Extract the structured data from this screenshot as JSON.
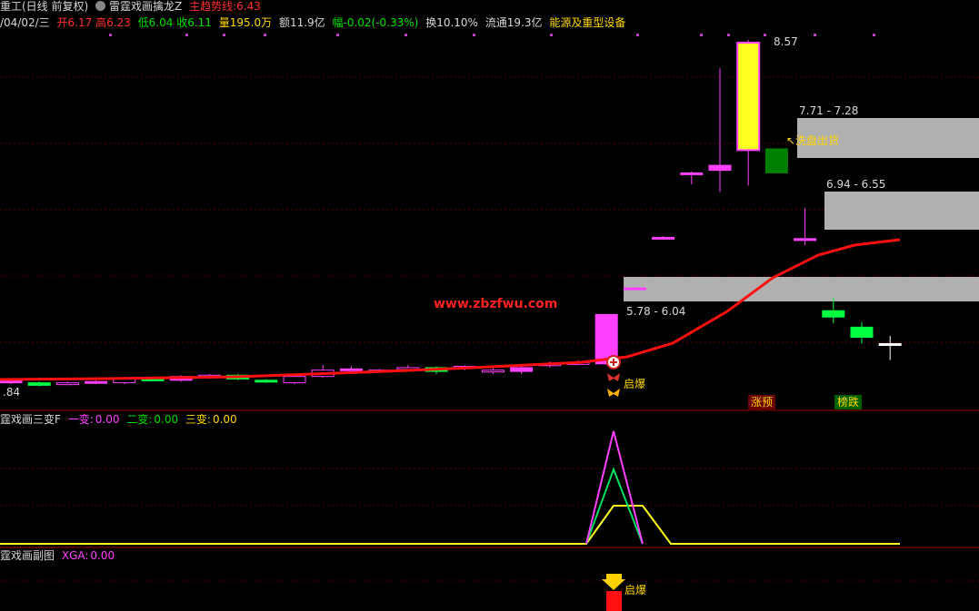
{
  "header": {
    "stock_name": "重工(日线 前复权)",
    "indicator_name": "雷霆戏画擒龙Z",
    "trend_label": "主趋势线:",
    "trend_value": "6.43",
    "date": "/04/02/三",
    "open_label": "开",
    "open": "6.17",
    "high_label": "高",
    "high": "6.23",
    "low_label": "低",
    "low": "6.04",
    "close_label": "收",
    "close": "6.11",
    "volume": "量195.0万",
    "amount": "额11.9亿",
    "change": "幅-0.02(-0.33%)",
    "turnover": "换10.10%",
    "float": "流通19.3亿",
    "sector": "能源及重型设备"
  },
  "panel2": {
    "title": "霆戏画三变F",
    "v1_label": "一变:",
    "v1": "0.00",
    "v2_label": "二变:",
    "v2": "0.00",
    "v3_label": "三变:",
    "v3": "0.00"
  },
  "panel3": {
    "title": "霆戏画副图",
    "xga_label": "XGA:",
    "xga": "0.00",
    "signal": "启爆"
  },
  "annotations": {
    "watermark": "www.zbzfwu.com",
    "high_label": "8.57",
    "low_axis": ".84",
    "zone1": "7.71 - 7.28",
    "zone2": "6.94 - 6.55",
    "zone3": "5.78 - 6.04",
    "washout": "↖洗盘出货",
    "burst": "启爆",
    "tag_up": "涨预",
    "tag_drop": "榜跌"
  },
  "colors": {
    "up": "#ff40ff",
    "down": "#00ff40",
    "ma": "#ff1010",
    "zone": "#b0b0b0",
    "big_up": "#ffff20",
    "big_down": "#008000"
  },
  "chart_data": {
    "type": "candlestick",
    "price_range": [
      5.8,
      8.6
    ],
    "candles": [
      {
        "o": 5.86,
        "c": 5.88,
        "h": 5.89,
        "l": 5.85
      },
      {
        "o": 5.86,
        "c": 5.84,
        "h": 5.87,
        "l": 5.83
      },
      {
        "o": 5.85,
        "c": 5.86,
        "h": 5.87,
        "l": 5.84
      },
      {
        "o": 5.86,
        "c": 5.87,
        "h": 5.88,
        "l": 5.85
      },
      {
        "o": 5.86,
        "c": 5.89,
        "h": 5.9,
        "l": 5.85
      },
      {
        "o": 5.89,
        "c": 5.88,
        "h": 5.9,
        "l": 5.87
      },
      {
        "o": 5.88,
        "c": 5.91,
        "h": 5.92,
        "l": 5.87
      },
      {
        "o": 5.9,
        "c": 5.92,
        "h": 5.93,
        "l": 5.89
      },
      {
        "o": 5.92,
        "c": 5.89,
        "h": 5.93,
        "l": 5.88
      },
      {
        "o": 5.88,
        "c": 5.87,
        "h": 5.89,
        "l": 5.86
      },
      {
        "o": 5.86,
        "c": 5.91,
        "h": 5.92,
        "l": 5.85
      },
      {
        "o": 5.91,
        "c": 5.96,
        "h": 6.0,
        "l": 5.9
      },
      {
        "o": 5.96,
        "c": 5.97,
        "h": 5.99,
        "l": 5.93
      },
      {
        "o": 5.96,
        "c": 5.96,
        "h": 5.97,
        "l": 5.94
      },
      {
        "o": 5.97,
        "c": 5.98,
        "h": 6.0,
        "l": 5.96
      },
      {
        "o": 5.98,
        "c": 5.95,
        "h": 5.99,
        "l": 5.93
      },
      {
        "o": 5.98,
        "c": 5.99,
        "h": 6.0,
        "l": 5.96
      },
      {
        "o": 5.95,
        "c": 5.96,
        "h": 5.98,
        "l": 5.93
      },
      {
        "o": 5.95,
        "c": 5.98,
        "h": 6.0,
        "l": 5.93
      },
      {
        "o": 6.0,
        "c": 6.01,
        "h": 6.03,
        "l": 5.98
      },
      {
        "o": 6.01,
        "c": 6.02,
        "h": 6.04,
        "l": 6.0
      },
      {
        "o": 6.01,
        "c": 6.4,
        "h": 6.4,
        "l": 6.0
      },
      {
        "o": 6.61,
        "c": 6.61,
        "h": 6.62,
        "l": 6.6
      },
      {
        "o": 7.01,
        "c": 7.01,
        "h": 7.02,
        "l": 7.0
      },
      {
        "o": 7.51,
        "c": 7.52,
        "h": 7.53,
        "l": 7.43
      },
      {
        "o": 7.54,
        "c": 7.58,
        "h": 8.35,
        "l": 7.37
      },
      {
        "o": 7.7,
        "c": 8.55,
        "h": 8.57,
        "l": 7.42
      },
      {
        "o": 7.71,
        "c": 7.52,
        "h": 7.71,
        "l": 7.52
      },
      {
        "o": 7.0,
        "c": 7.0,
        "h": 7.24,
        "l": 6.95
      },
      {
        "o": 6.43,
        "c": 6.38,
        "h": 6.53,
        "l": 6.33
      },
      {
        "o": 6.3,
        "c": 6.22,
        "h": 6.34,
        "l": 6.17
      },
      {
        "o": 6.16,
        "c": 6.17,
        "h": 6.23,
        "l": 6.04
      }
    ]
  }
}
